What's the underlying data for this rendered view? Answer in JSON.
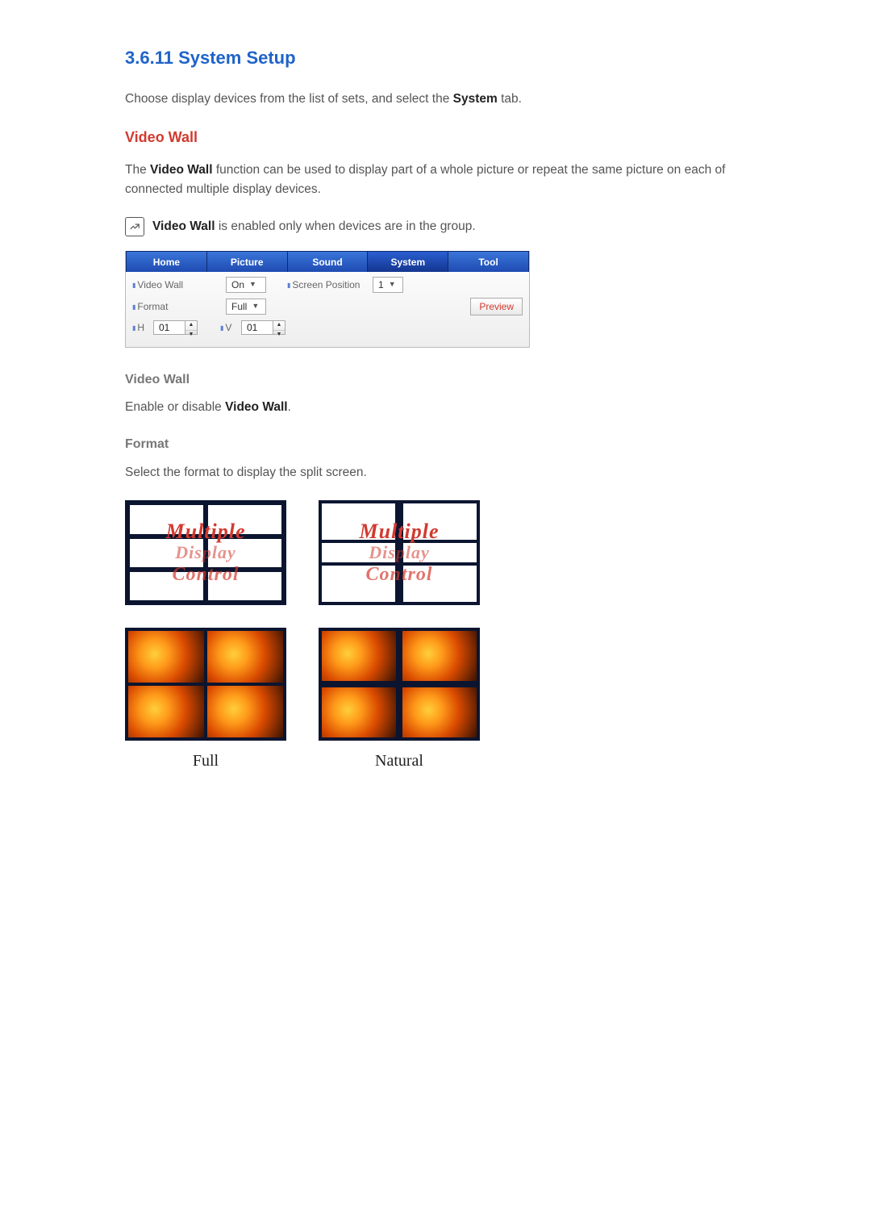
{
  "heading": "3.6.11   System Setup",
  "intro_before": "Choose display devices from the list of sets, and select the ",
  "intro_bold": "System",
  "intro_after": " tab.",
  "video_wall_heading": "Video Wall",
  "video_wall_p1_before": "The ",
  "video_wall_p1_bold": "Video Wall",
  "video_wall_p1_after": " function can be used to display part of a whole picture or repeat the same picture on each of connected multiple display devices.",
  "note_bold": "Video Wall",
  "note_after": " is enabled only when devices are in the group.",
  "tabs": {
    "home": "Home",
    "picture": "Picture",
    "sound": "Sound",
    "system": "System",
    "tool": "Tool"
  },
  "panel": {
    "video_wall_label": "Video Wall",
    "video_wall_value": "On",
    "screen_position_label": "Screen Position",
    "screen_position_value": "1",
    "format_label": "Format",
    "format_value": "Full",
    "preview_label": "Preview",
    "h_label": "H",
    "h_value": "01",
    "v_label": "V",
    "v_value": "01"
  },
  "sub_video_wall": "Video Wall",
  "sub_video_wall_before": "Enable or disable ",
  "sub_video_wall_bold": "Video Wall",
  "sub_video_wall_after": ".",
  "sub_format": "Format",
  "sub_format_text": "Select the format to display the split screen.",
  "diagram_text": {
    "l1": "Multiple",
    "l2": "Display",
    "l3": "Control"
  },
  "caption_full": "Full",
  "caption_natural": "Natural"
}
